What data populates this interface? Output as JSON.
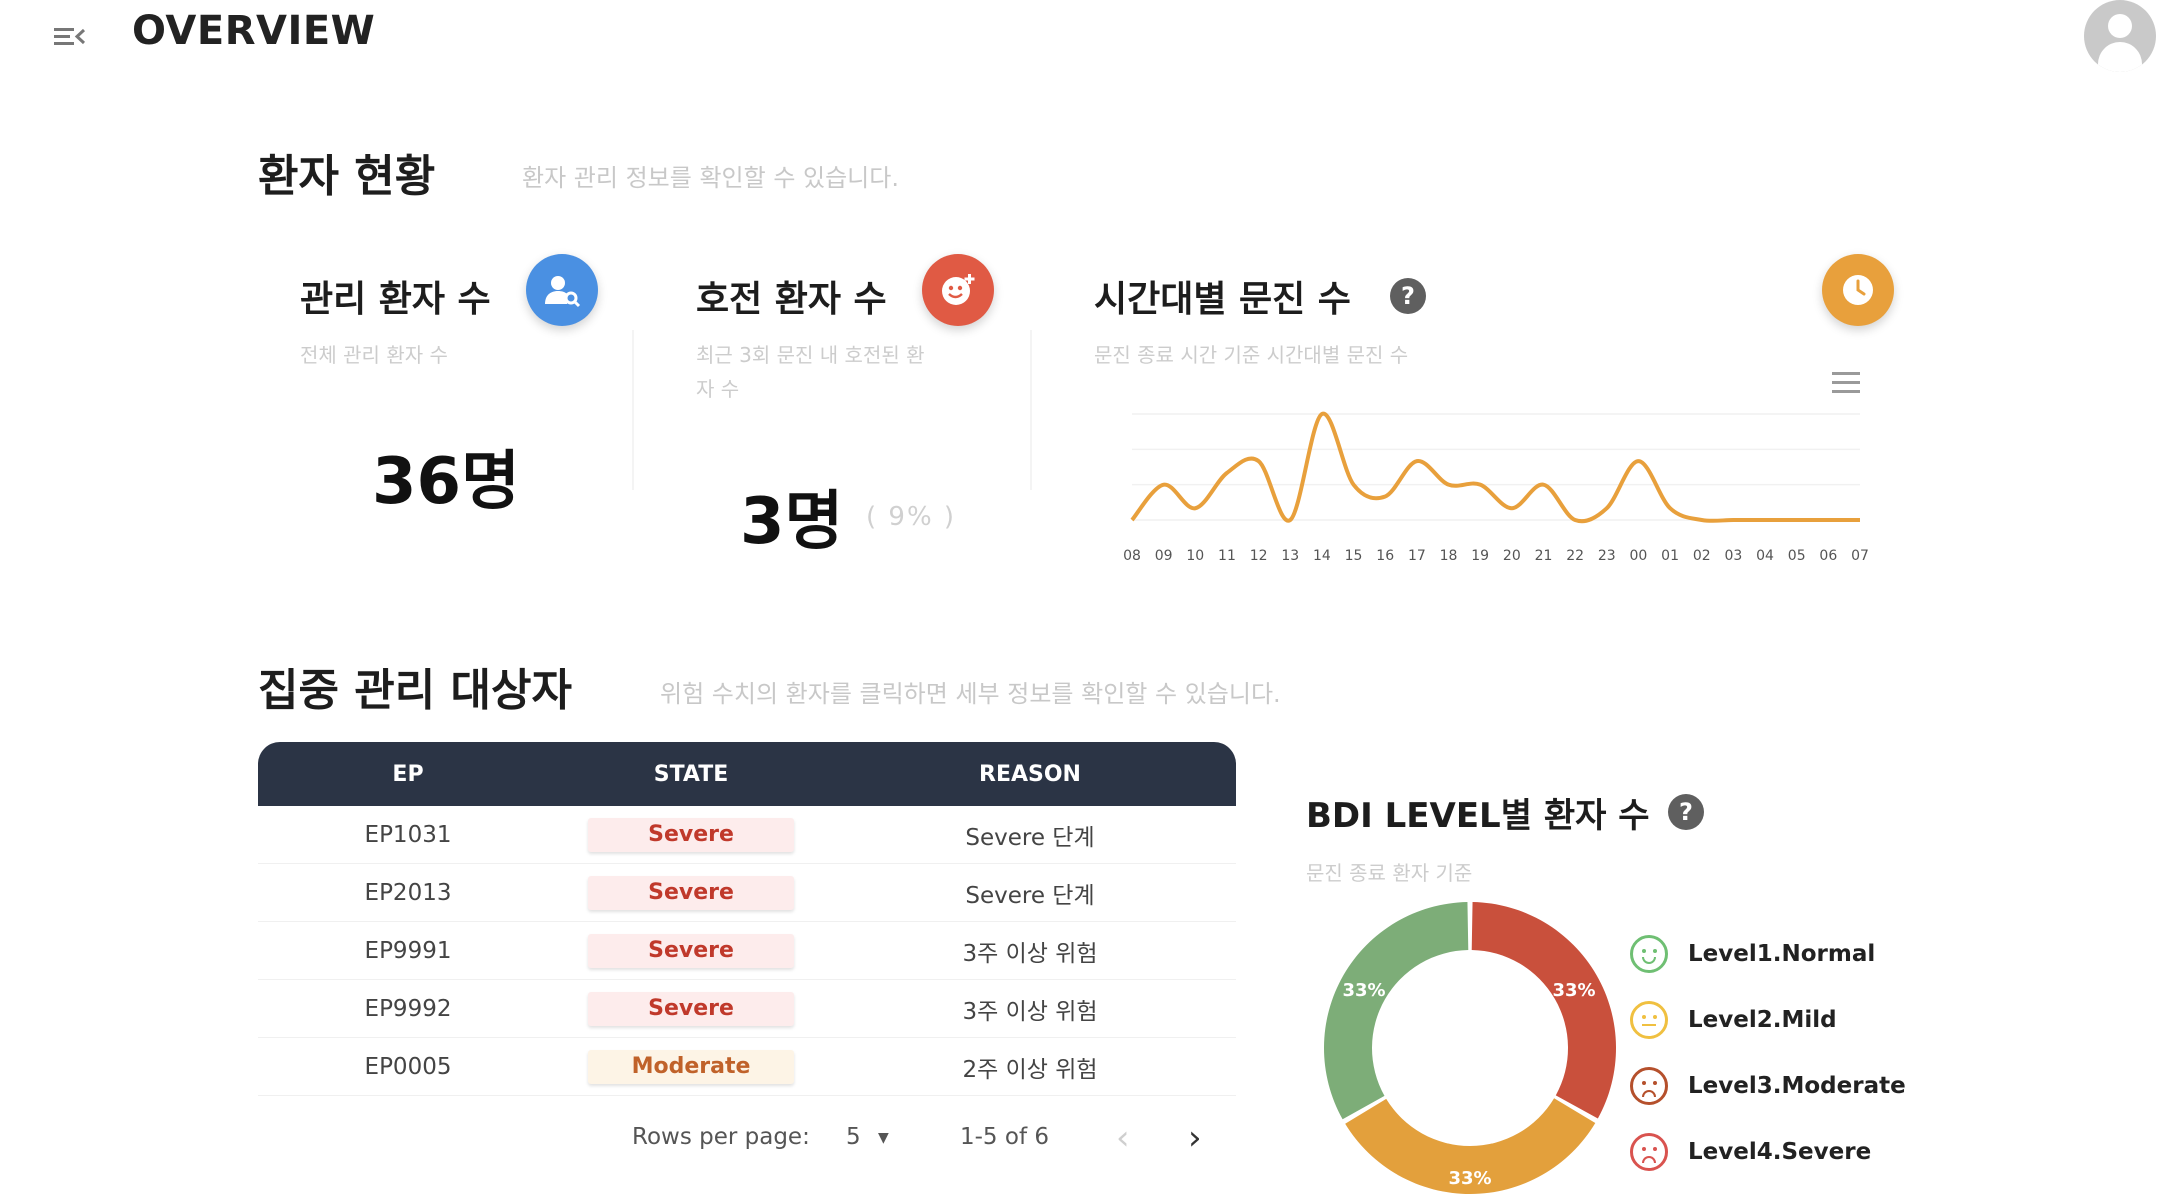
{
  "header": {
    "title": "OVERVIEW"
  },
  "status_section": {
    "title": "환자 현황",
    "desc": "환자 관리 정보를 확인할 수 있습니다.",
    "managed": {
      "title": "관리 환자 수",
      "sub": "전체 관리 환자 수",
      "value": "36명",
      "icon": "user-search-icon",
      "color": "#4a90e2"
    },
    "improved": {
      "title": "호전 환자 수",
      "sub_line1": "최근 3회 문진 내 호전된 환",
      "sub_line2": "자 수",
      "value": "3명",
      "percent": "( 9% )",
      "icon": "smile-plus-icon",
      "color": "#e05a44"
    },
    "hourly": {
      "title": "시간대별 문진 수",
      "sub": "문진 종료 시간 기준 시간대별 문진 수",
      "icon": "clock-icon",
      "color": "#e8a03c"
    }
  },
  "chart_data": {
    "type": "line",
    "x": [
      "08",
      "09",
      "10",
      "11",
      "12",
      "13",
      "14",
      "15",
      "16",
      "17",
      "18",
      "19",
      "20",
      "21",
      "22",
      "23",
      "00",
      "01",
      "02",
      "03",
      "04",
      "05",
      "06",
      "07"
    ],
    "series": [
      {
        "values": [
          0,
          3,
          1,
          4,
          5,
          0,
          9,
          3,
          2,
          5,
          3,
          3,
          1,
          3,
          0,
          1,
          5,
          1,
          0,
          0,
          0,
          0,
          0,
          0
        ]
      }
    ],
    "color": "#e8a03c",
    "grid": true
  },
  "focus_section": {
    "title": "집중 관리 대상자",
    "desc": "위험 수치의 환자를 클릭하면 세부 정보를 확인할 수 있습니다."
  },
  "table": {
    "headers": [
      "EP",
      "STATE",
      "REASON"
    ],
    "rows": [
      {
        "ep": "EP1031",
        "state": "Severe",
        "reason": "Severe 단계"
      },
      {
        "ep": "EP2013",
        "state": "Severe",
        "reason": "Severe 단계"
      },
      {
        "ep": "EP9991",
        "state": "Severe",
        "reason": "3주 이상 위험"
      },
      {
        "ep": "EP9992",
        "state": "Severe",
        "reason": "3주 이상 위험"
      },
      {
        "ep": "EP0005",
        "state": "Moderate",
        "reason": "2주 이상 위험"
      }
    ]
  },
  "pager": {
    "rows_label": "Rows per page:",
    "rows_value": "5",
    "range": "1-5 of 6"
  },
  "bdi": {
    "title": "BDI LEVEL별 환자 수",
    "sub": "문진 종료 환자 기준",
    "legend": [
      {
        "label": "Level1.Normal",
        "color": "#6fbf73",
        "face": "smile"
      },
      {
        "label": "Level2.Mild",
        "color": "#f0c040",
        "face": "neutral"
      },
      {
        "label": "Level3.Moderate",
        "color": "#b5502c",
        "face": "slight-frown"
      },
      {
        "label": "Level4.Severe",
        "color": "#d9534f",
        "face": "sad"
      }
    ],
    "donut": [
      {
        "label": "33%",
        "value": 33.3,
        "color": "#c9503c"
      },
      {
        "label": "33%",
        "value": 33.3,
        "color": "#e3a03c"
      },
      {
        "label": "33%",
        "value": 33.4,
        "color": "#7dad78"
      }
    ]
  }
}
